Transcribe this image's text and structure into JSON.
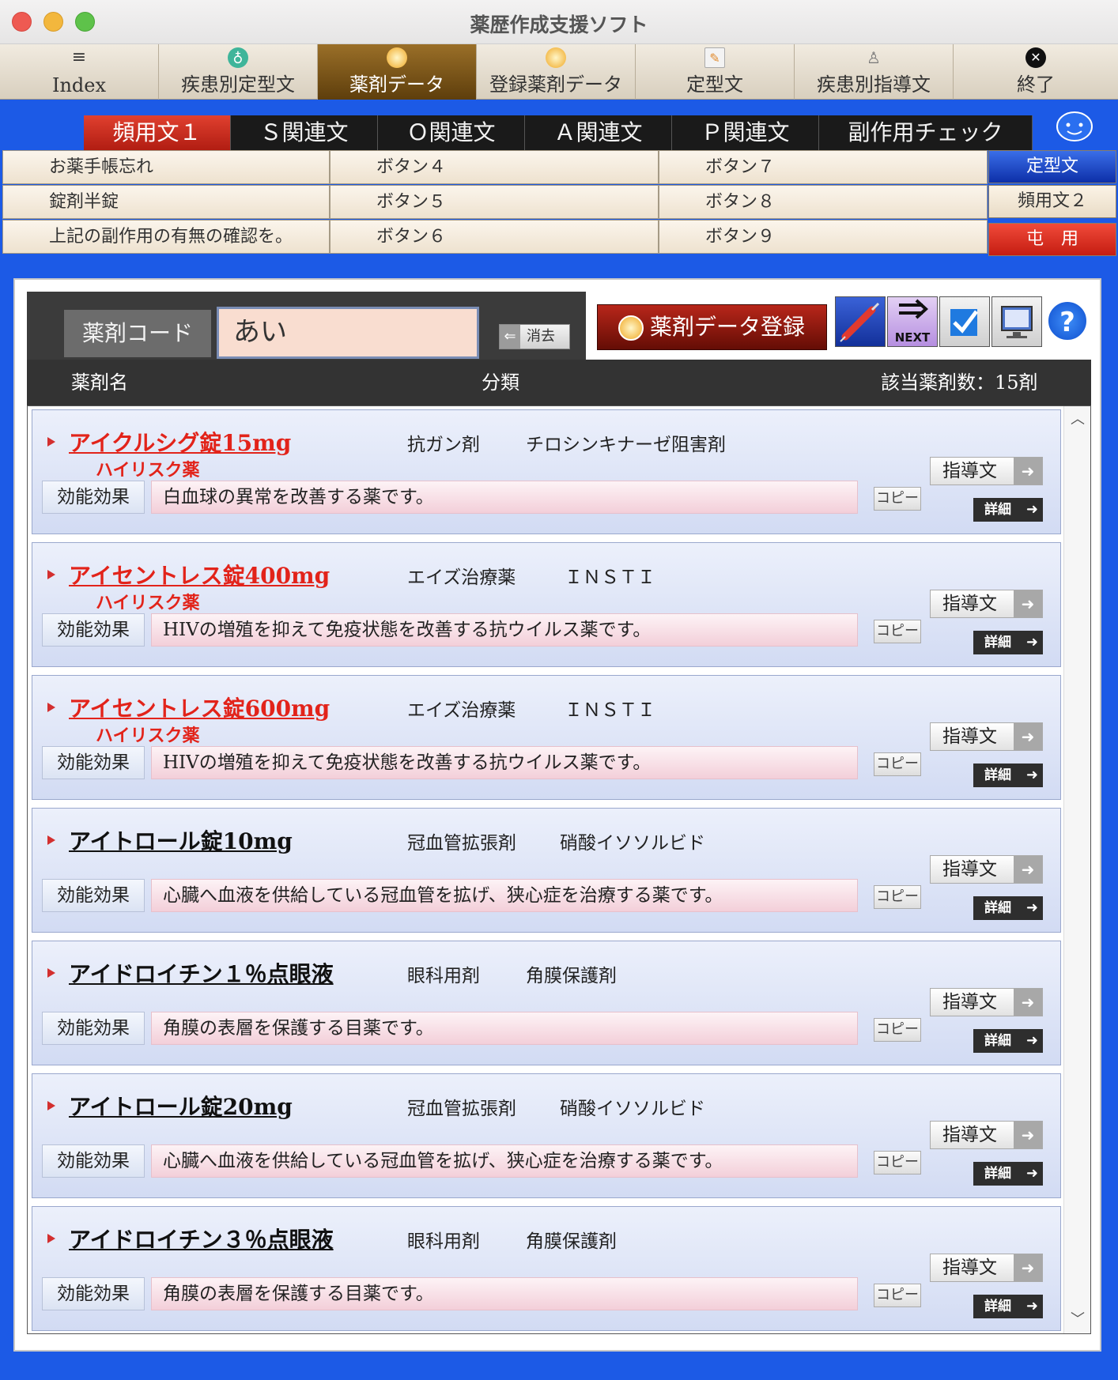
{
  "window": {
    "title": "薬歴作成支援ソフト"
  },
  "toolbar": [
    {
      "label": "Index",
      "icon": "list-icon"
    },
    {
      "label": "疾患別定型文",
      "icon": "stethoscope-icon"
    },
    {
      "label": "薬剤データ",
      "icon": "pill-icon"
    },
    {
      "label": "登録薬剤データ",
      "icon": "pill-icon"
    },
    {
      "label": "定型文",
      "icon": "notepad-icon"
    },
    {
      "label": "疾患別指導文",
      "icon": "person-icon"
    },
    {
      "label": "終了",
      "icon": "close-icon"
    }
  ],
  "tabs": [
    "頻用文１",
    "Ｓ関連文",
    "Ｏ関連文",
    "Ａ関連文",
    "Ｐ関連文",
    "副作用チェック"
  ],
  "phrases": [
    [
      "お薬手帳忘れ",
      "ボタン４",
      "ボタン７"
    ],
    [
      "錠剤半錠",
      "ボタン５",
      "ボタン８"
    ],
    [
      "上記の副作用の有無の確認を。",
      "ボタン６",
      "ボタン９"
    ]
  ],
  "side_buttons": [
    "定型文",
    "頻用文２",
    "屯　用"
  ],
  "search": {
    "code_label": "薬剤コード",
    "code_value": "あい",
    "clear_label": "消去",
    "register_label": "薬剤データ登録",
    "help_label": "?",
    "next_label": "NEXT"
  },
  "list_header": {
    "name": "薬剤名",
    "category": "分類",
    "count": "該当薬剤数：15剤"
  },
  "colors": {
    "accent_blue": "#1c5ae6",
    "high_risk": "#e2231a",
    "active_tab": "#c8281a"
  },
  "labels": {
    "efficacy": "効能効果",
    "copy": "コピー",
    "guide": "指導文",
    "detail": "詳細"
  },
  "drugs": [
    {
      "name": "アイクルシグ錠15mg",
      "high_risk": true,
      "risk_label": "ハイリスク薬",
      "category": "抗ガン剤",
      "subcategory": "チロシンキナーゼ阻害剤",
      "efficacy": "白血球の異常を改善する薬です。"
    },
    {
      "name": "アイセントレス錠400mg",
      "high_risk": true,
      "risk_label": "ハイリスク薬",
      "category": "エイズ治療薬",
      "subcategory": "ＩＮＳＴＩ",
      "efficacy": "HIVの増殖を抑えて免疫状態を改善する抗ウイルス薬です。"
    },
    {
      "name": "アイセントレス錠600mg",
      "high_risk": true,
      "risk_label": "ハイリスク薬",
      "category": "エイズ治療薬",
      "subcategory": "ＩＮＳＴＩ",
      "efficacy": "HIVの増殖を抑えて免疫状態を改善する抗ウイルス薬です。"
    },
    {
      "name": "アイトロール錠10mg",
      "high_risk": false,
      "risk_label": "",
      "category": "冠血管拡張剤",
      "subcategory": "硝酸イソソルビド",
      "efficacy": "心臓へ血液を供給している冠血管を拡げ、狭心症を治療する薬です。"
    },
    {
      "name": "アイドロイチン１％点眼液",
      "high_risk": false,
      "risk_label": "",
      "category": "眼科用剤",
      "subcategory": "角膜保護剤",
      "efficacy": "角膜の表層を保護する目薬です。"
    },
    {
      "name": "アイトロール錠20mg",
      "high_risk": false,
      "risk_label": "",
      "category": "冠血管拡張剤",
      "subcategory": "硝酸イソソルビド",
      "efficacy": "心臓へ血液を供給している冠血管を拡げ、狭心症を治療する薬です。"
    },
    {
      "name": "アイドロイチン３％点眼液",
      "high_risk": false,
      "risk_label": "",
      "category": "眼科用剤",
      "subcategory": "角膜保護剤",
      "efficacy": "角膜の表層を保護する目薬です。"
    }
  ]
}
